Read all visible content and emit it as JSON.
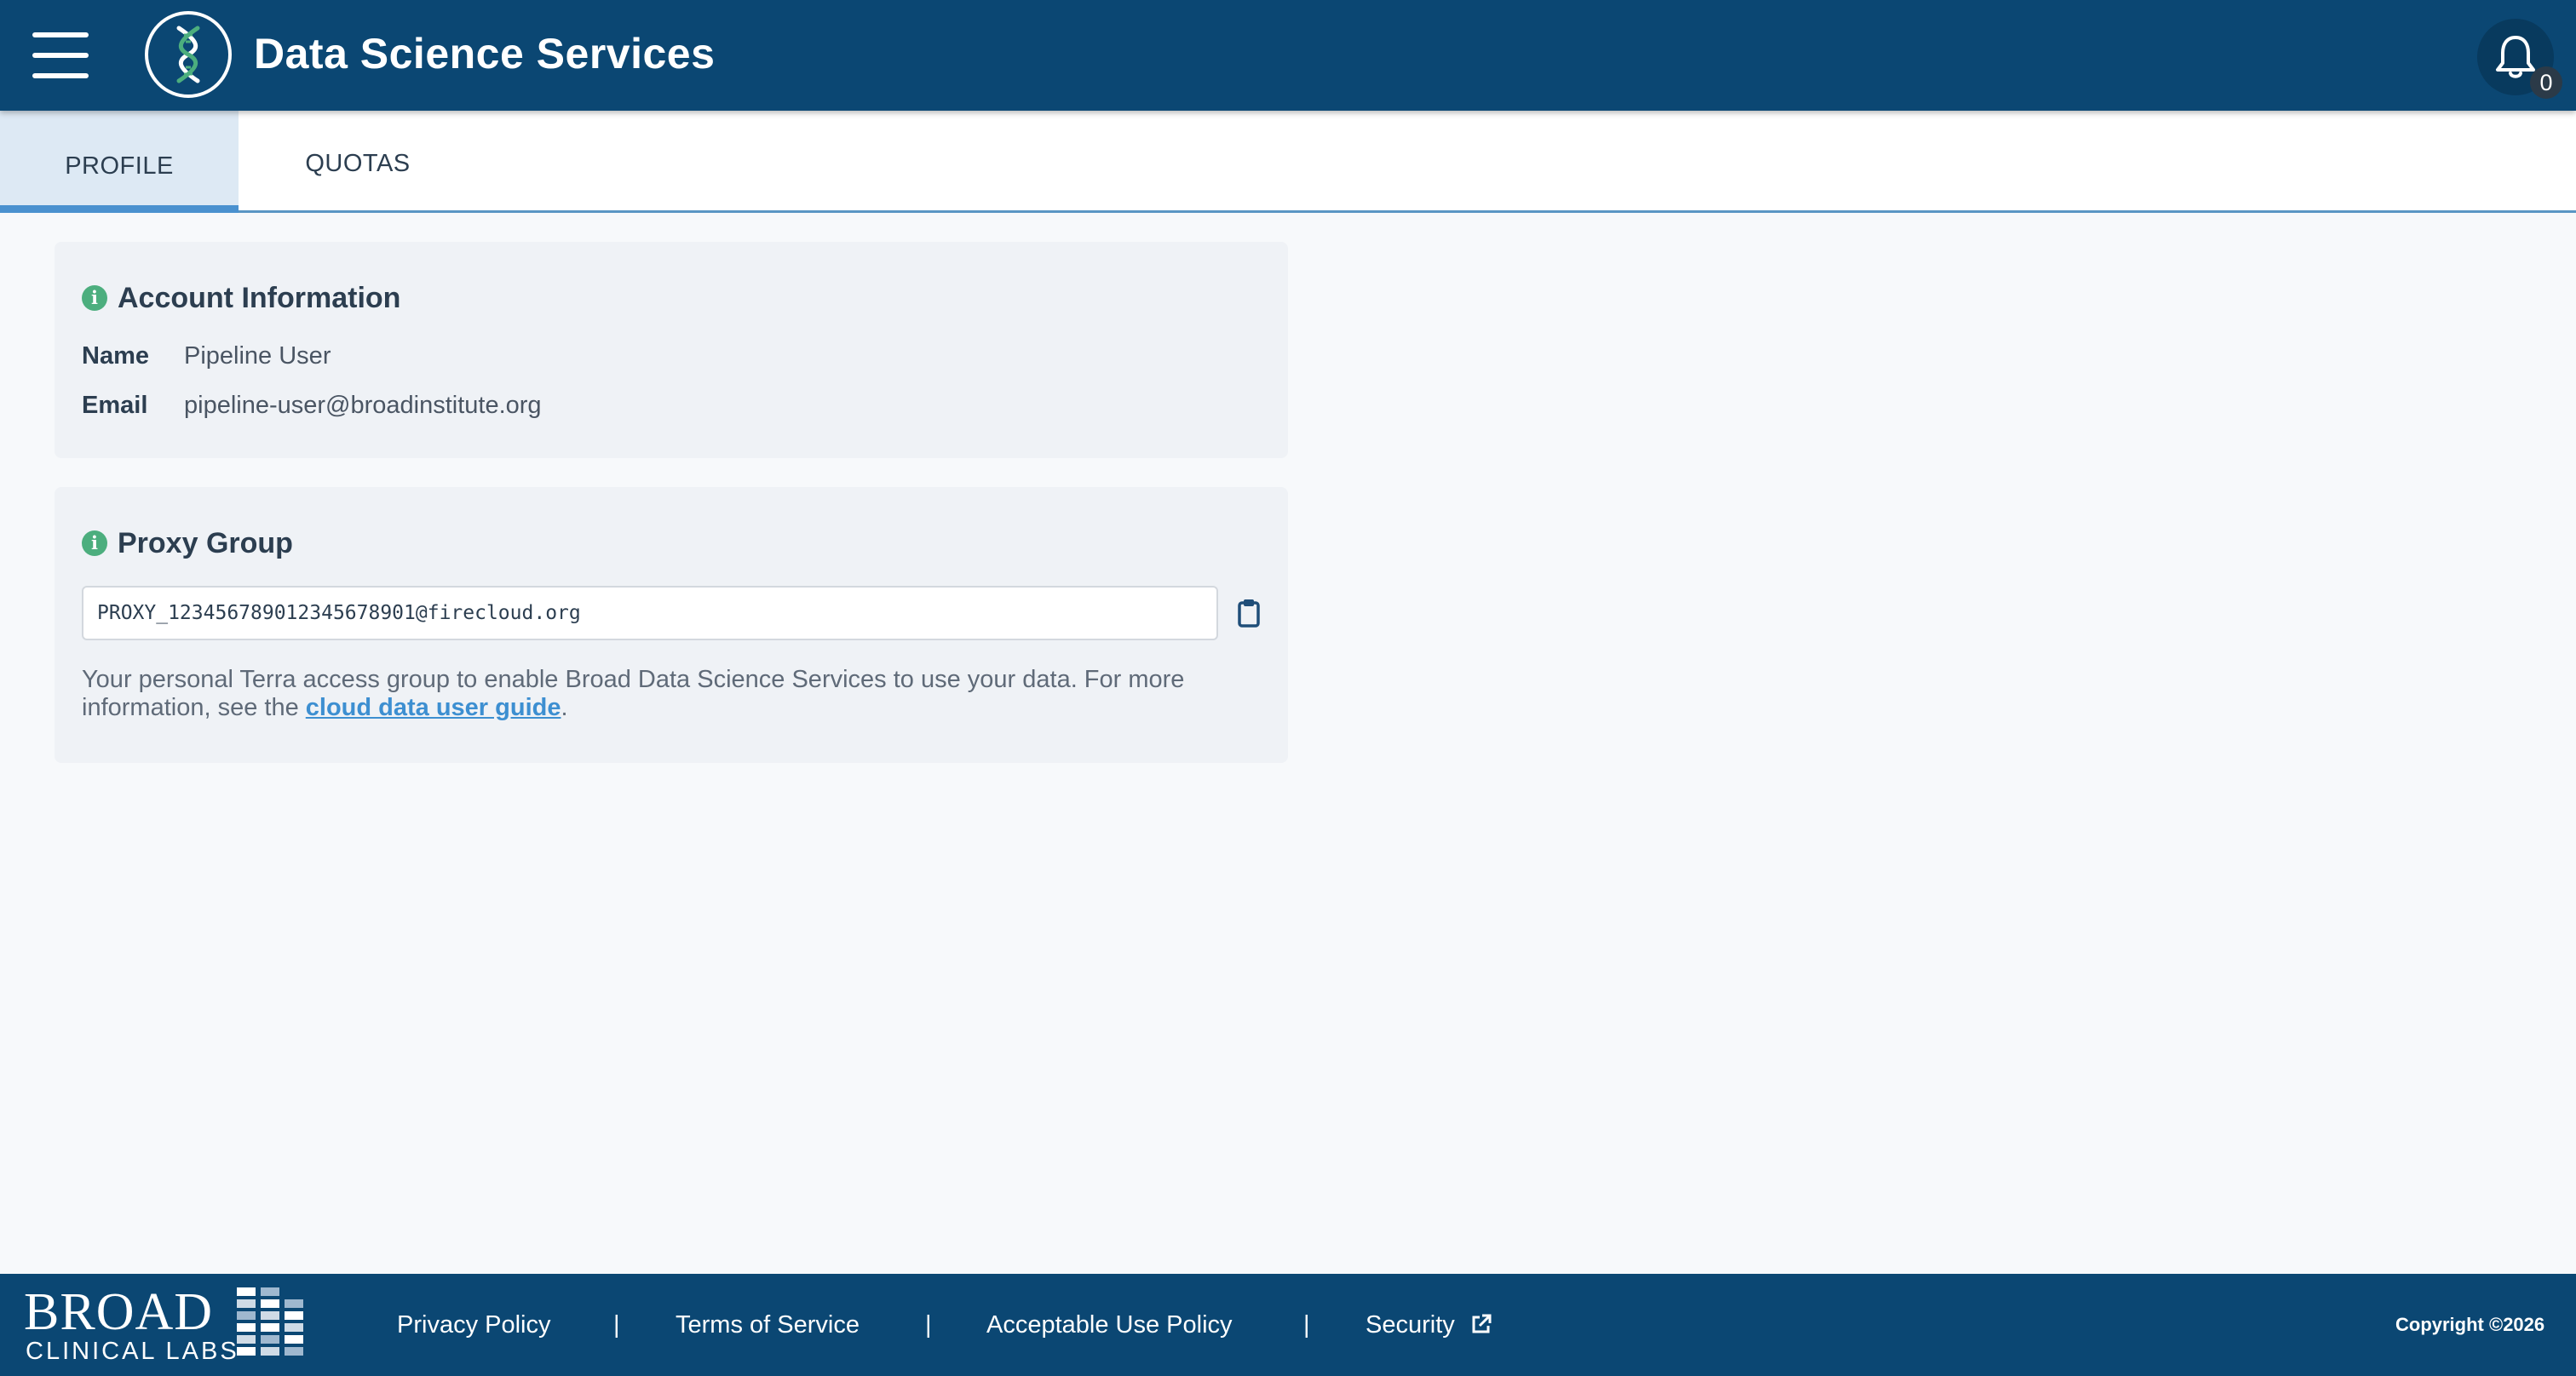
{
  "header": {
    "title": "Data Science Services",
    "notification_count": "0"
  },
  "tabs": [
    {
      "label": "PROFILE",
      "active": true
    },
    {
      "label": "QUOTAS",
      "active": false
    }
  ],
  "account": {
    "title": "Account Information",
    "name_label": "Name",
    "name_value": "Pipeline User",
    "email_label": "Email",
    "email_value": "pipeline-user@broadinstitute.org"
  },
  "proxy": {
    "title": "Proxy Group",
    "value": "PROXY_12345678901234567890​1@firecloud.org",
    "desc_before": "Your personal Terra access group to enable Broad Data Science Services to use your data. For more information, see the ",
    "link_text": "cloud data user guide",
    "desc_after": "."
  },
  "footer": {
    "logo_top": "BROAD",
    "logo_bottom": "CLINICAL LABS",
    "links": [
      "Privacy Policy",
      "Terms of Service",
      "Acceptable Use Policy",
      "Security"
    ],
    "separator": "|",
    "copyright": "Copyright ©2026"
  },
  "colors": {
    "header_bg": "#0b4773",
    "tab_active_bg": "#dde9f4",
    "tab_active_border": "#4a91cf",
    "info_icon": "#4cae7e",
    "link": "#3d8fd1"
  },
  "icons": {
    "menu": "hamburger-icon",
    "logo": "dna-helix-icon",
    "notifications": "bell-icon",
    "info": "info-icon",
    "copy": "clipboard-icon",
    "external": "external-link-icon"
  }
}
